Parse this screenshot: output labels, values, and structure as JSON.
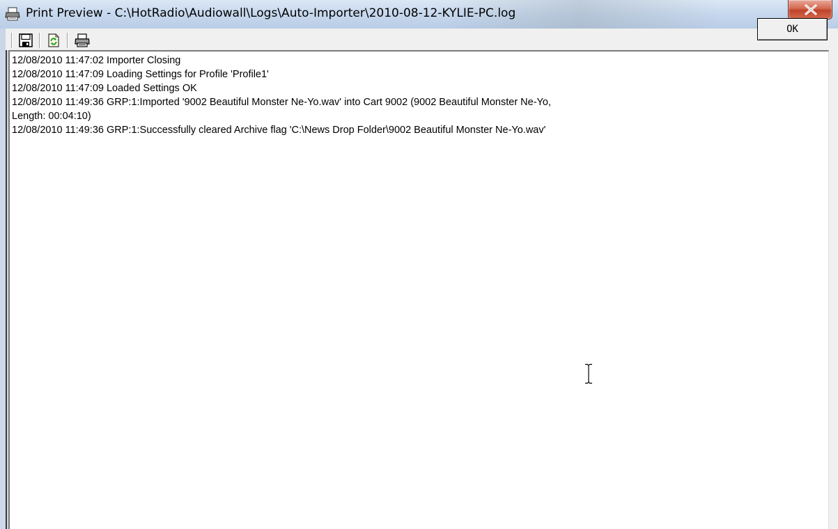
{
  "window": {
    "title": "Print Preview - C:\\HotRadio\\Audiowall\\Logs\\Auto-Importer\\2010-08-12-KYLIE-PC.log",
    "close_glyph": "X"
  },
  "toolbar": {
    "buttons": [
      {
        "icon": "save-icon"
      },
      {
        "icon": "refresh-icon"
      },
      {
        "icon": "printer-icon"
      }
    ],
    "ok_label": "OK"
  },
  "log": {
    "lines": [
      "12/08/2010 11:47:02 Importer Closing",
      "12/08/2010 11:47:09 Loading Settings for Profile 'Profile1'",
      "12/08/2010 11:47:09 Loaded Settings OK",
      "12/08/2010 11:49:36 GRP:1:Imported '9002 Beautiful Monster Ne-Yo.wav' into Cart 9002 (9002 Beautiful Monster Ne-Yo,",
      "Length: 00:04:10)",
      "12/08/2010 11:49:36 GRP:1:Successfully cleared Archive flag 'C:\\News Drop Folder\\9002 Beautiful Monster Ne-Yo.wav'"
    ]
  },
  "colors": {
    "title_bar": "#c8d9ee",
    "close_button": "#c0432b",
    "client_bg": "#f0f0f0",
    "preview_bg": "#ffffff"
  }
}
